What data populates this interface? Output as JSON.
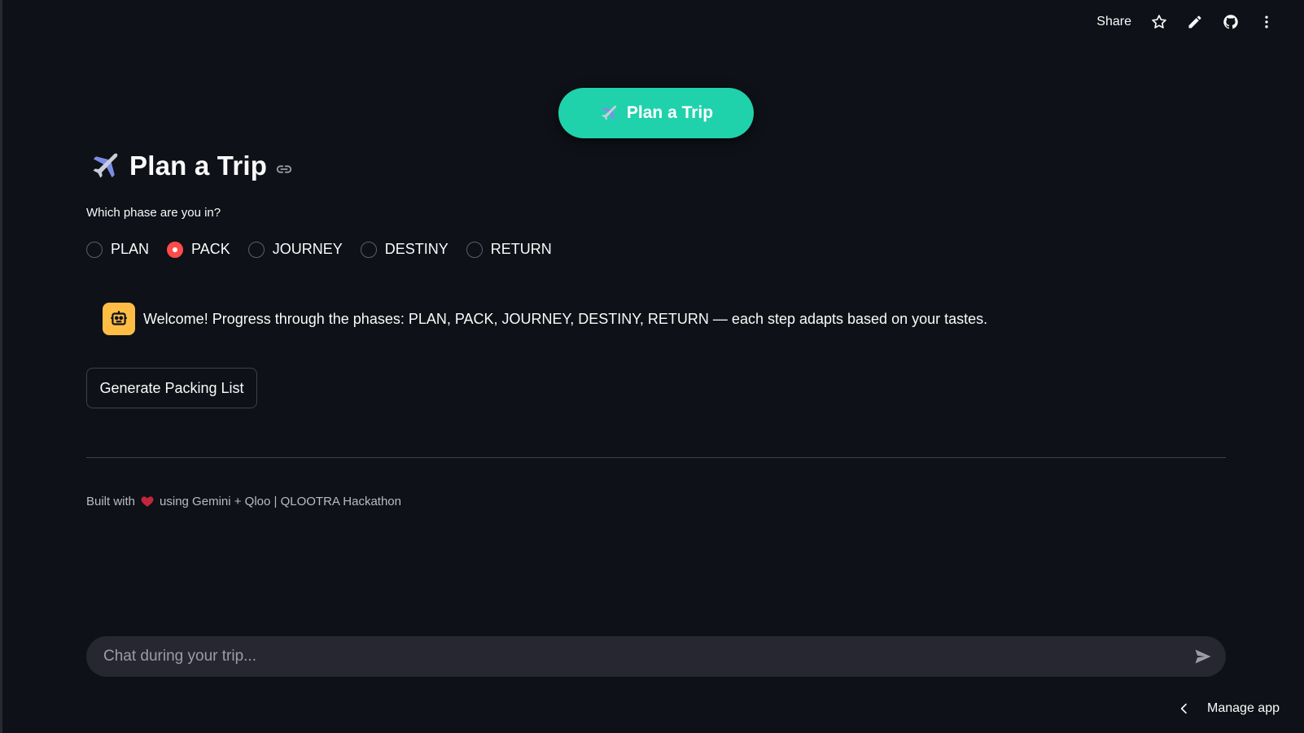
{
  "toolbar": {
    "share_label": "Share",
    "icons": [
      "star-icon",
      "pencil-icon",
      "github-icon",
      "more-vertical-icon"
    ]
  },
  "hero": {
    "label": "Plan a Trip",
    "icon": "airplane-icon",
    "color": "#1fd2ac"
  },
  "title": {
    "text": "Plan a Trip",
    "icon": "airplane-icon"
  },
  "phase": {
    "question": "Which phase are you in?",
    "options": [
      "PLAN",
      "PACK",
      "JOURNEY",
      "DESTINY",
      "RETURN"
    ],
    "selected": "PACK",
    "accent": "#ff4b4b"
  },
  "message": {
    "avatar_icon": "robot-icon",
    "avatar_color": "#ffbd45",
    "text": "Welcome! Progress through the phases: PLAN, PACK, JOURNEY, DESTINY, RETURN — each step adapts based on your tastes."
  },
  "actions": {
    "generate_label": "Generate Packing List"
  },
  "footer": {
    "prefix": "Built with",
    "suffix": "using Gemini + Qloo | QLOOTRA Hackathon"
  },
  "chat": {
    "placeholder": "Chat during your trip...",
    "value": ""
  },
  "manage": {
    "label": "Manage app"
  }
}
